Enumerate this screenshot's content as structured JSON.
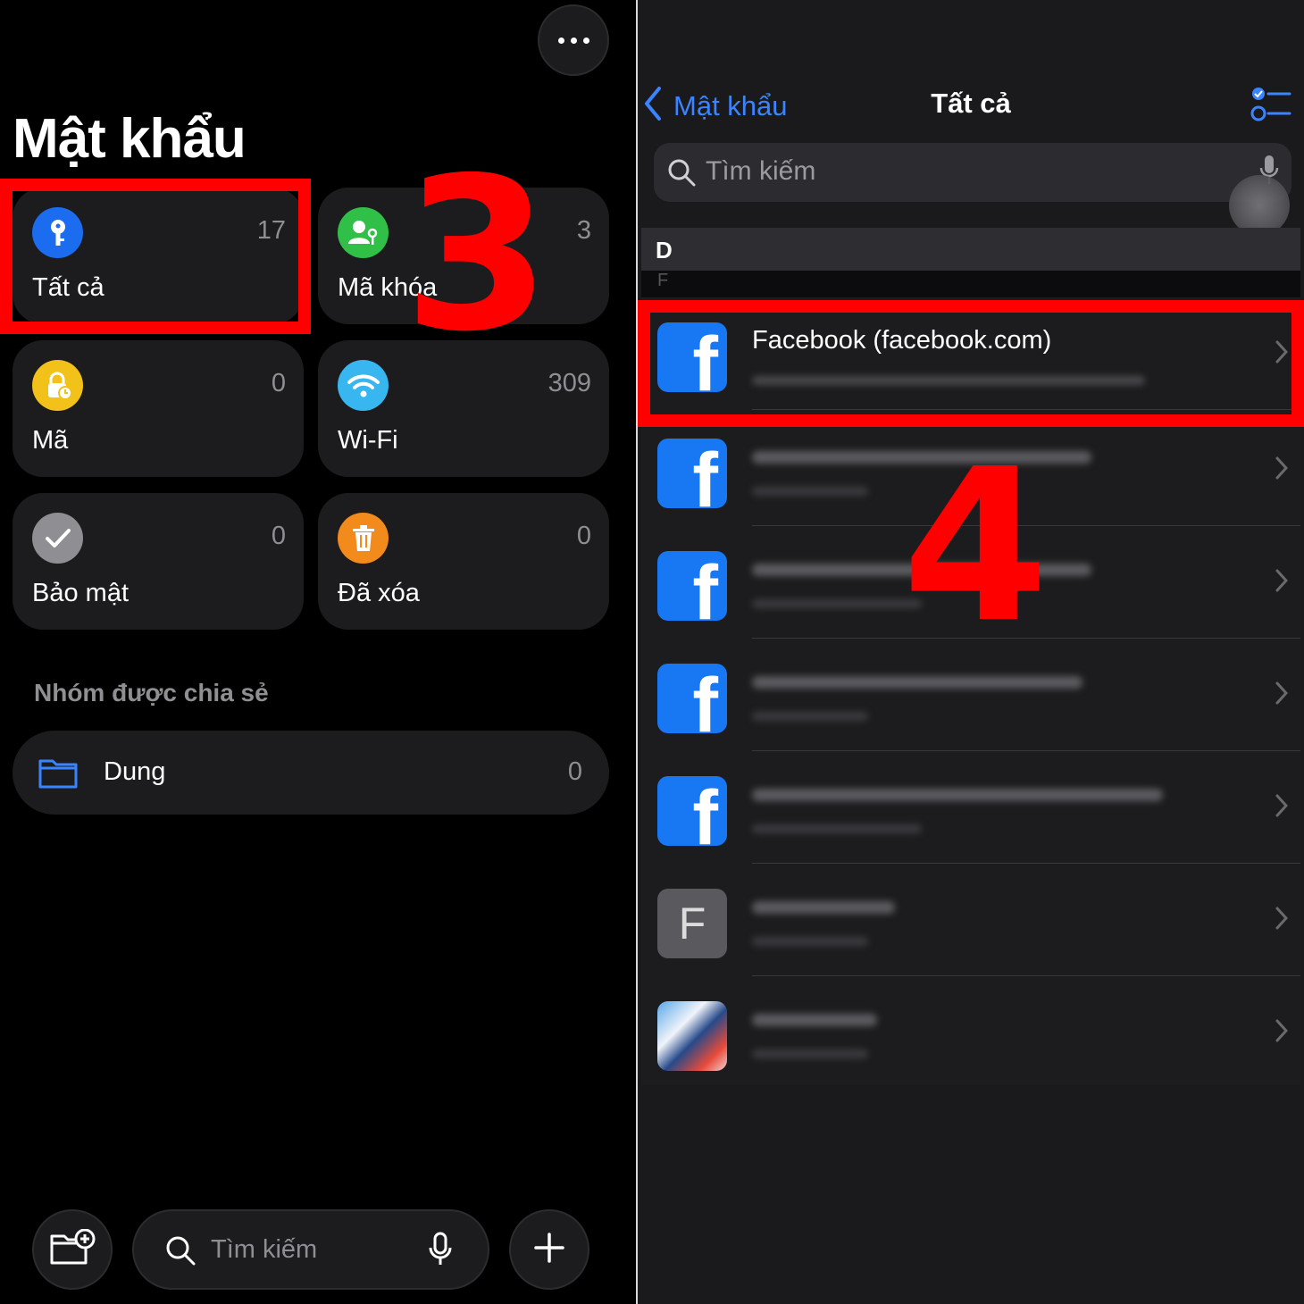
{
  "left": {
    "title": "Mật khẩu",
    "tiles": [
      {
        "label": "Tất cả",
        "count": "17",
        "icon": "key-icon",
        "color": "#1c6cf0"
      },
      {
        "label": "Mã khóa",
        "count": "3",
        "icon": "person-key-icon",
        "color": "#30c048"
      },
      {
        "label": "Mã",
        "count": "0",
        "icon": "lock-clock-icon",
        "color": "#f2c21a"
      },
      {
        "label": "Wi-Fi",
        "count": "309",
        "icon": "wifi-icon",
        "color": "#38b6f0"
      },
      {
        "label": "Bảo mật",
        "count": "0",
        "icon": "checkmark-icon",
        "color": "#8e8e93"
      },
      {
        "label": "Đã xóa",
        "count": "0",
        "icon": "trash-icon",
        "color": "#f28a1c"
      }
    ],
    "shared_section_label": "Nhóm được chia sẻ",
    "group": {
      "label": "Dung",
      "count": "0",
      "icon": "folder-icon"
    },
    "bottom_bar": {
      "new_folder_icon": "folder-plus-icon",
      "search_placeholder": "Tìm kiếm",
      "mic_icon": "microphone-icon",
      "add_icon": "plus-icon"
    }
  },
  "right": {
    "back_label": "Mật khẩu",
    "title": "Tất cả",
    "search_placeholder": "Tìm kiếm",
    "section_letter": "D",
    "section_letter_next": "F",
    "rows": [
      {
        "title": "Facebook (facebook.com)",
        "icon_type": "facebook-icon"
      },
      {
        "title": "",
        "icon_type": "facebook-icon"
      },
      {
        "title": "",
        "icon_type": "facebook-icon"
      },
      {
        "title": "",
        "icon_type": "facebook-icon"
      },
      {
        "title": "",
        "icon_type": "facebook-icon"
      },
      {
        "title": "",
        "icon_type": "letter-f-icon",
        "letter": "F"
      },
      {
        "title": "",
        "icon_type": "game-app-icon"
      }
    ]
  },
  "annotations": {
    "step3": "3",
    "step4": "4",
    "highlight_color": "#ff0000"
  }
}
